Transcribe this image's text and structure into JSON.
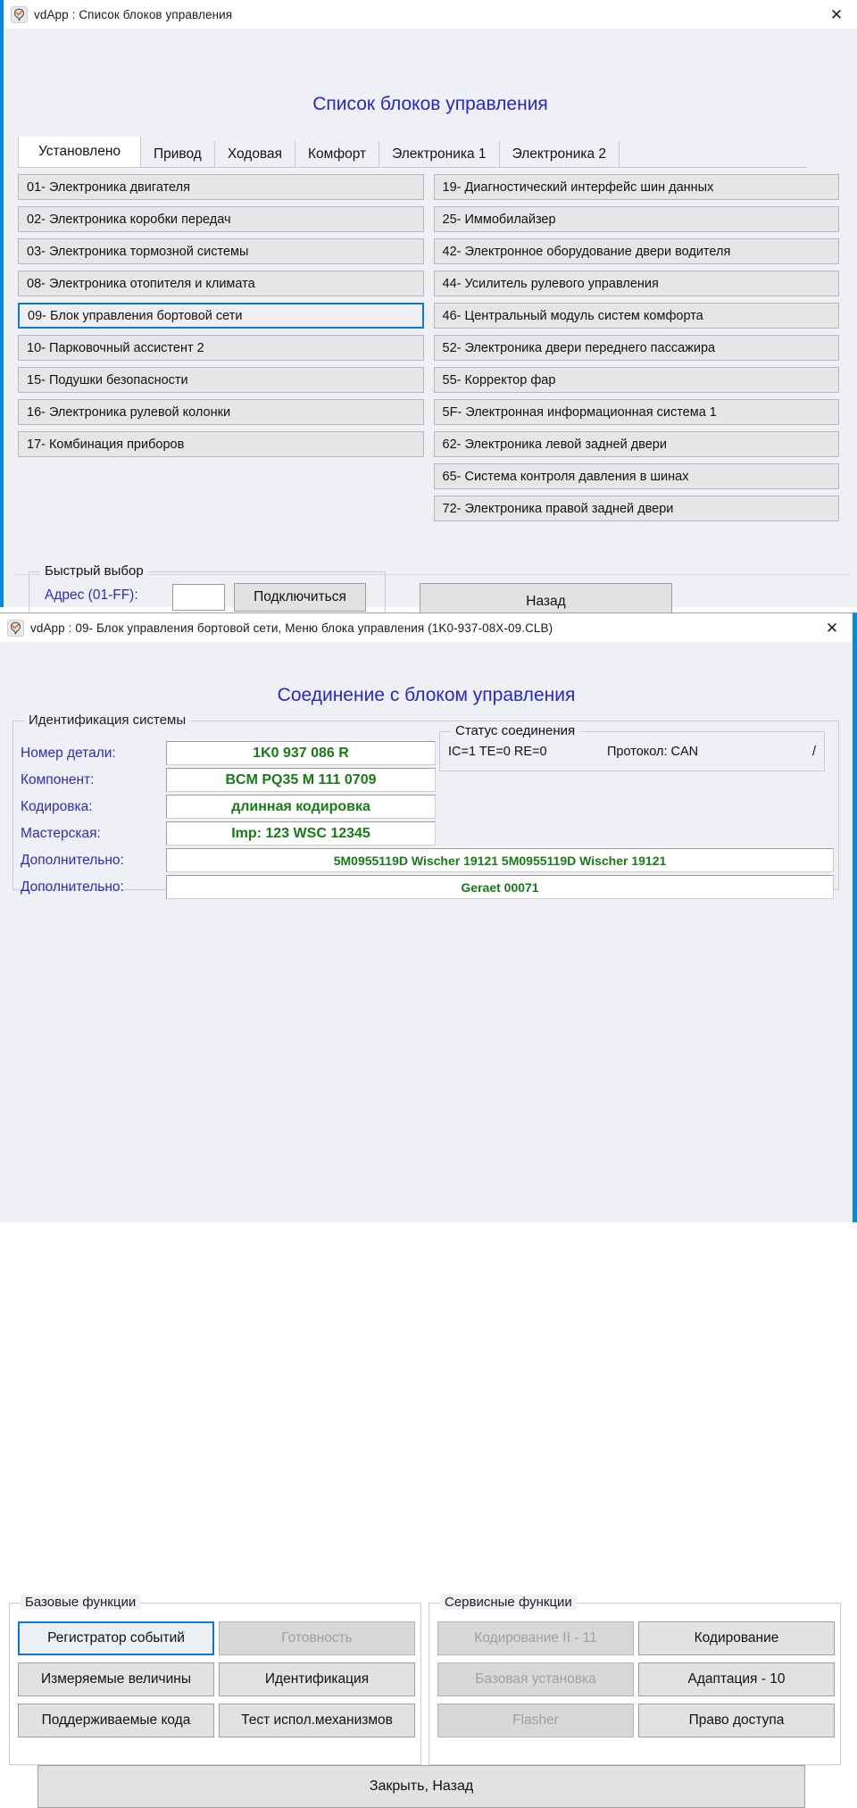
{
  "window1": {
    "title": "vdApp :  Список блоков управления",
    "close_label": "✕",
    "heading": "Список блоков управления",
    "tabs": [
      {
        "label": "Установлено",
        "active": true
      },
      {
        "label": "Привод",
        "active": false
      },
      {
        "label": "Ходовая",
        "active": false
      },
      {
        "label": "Комфорт",
        "active": false
      },
      {
        "label": "Электроника 1",
        "active": false
      },
      {
        "label": "Электроника 2",
        "active": false
      }
    ],
    "ecu_left": [
      {
        "label": "01- Электроника двигателя",
        "selected": false
      },
      {
        "label": "02- Электроника коробки передач",
        "selected": false
      },
      {
        "label": "03- Электроника тормозной системы",
        "selected": false
      },
      {
        "label": "08- Электроника отопителя и климата",
        "selected": false
      },
      {
        "label": "09- Блок управления бортовой сети",
        "selected": true
      },
      {
        "label": "10- Парковочный ассистент 2",
        "selected": false
      },
      {
        "label": "15- Подушки безопасности",
        "selected": false
      },
      {
        "label": "16- Электроника рулевой колонки",
        "selected": false
      },
      {
        "label": "17- Комбинация приборов",
        "selected": false
      }
    ],
    "ecu_right": [
      {
        "label": "19- Диагностический интерфейс шин данных",
        "selected": false
      },
      {
        "label": "25- Иммобилайзер",
        "selected": false
      },
      {
        "label": "42- Электронное оборудование двери водителя",
        "selected": false
      },
      {
        "label": "44- Усилитель рулевого управления",
        "selected": false
      },
      {
        "label": "46- Центральный модуль систем комфорта",
        "selected": false
      },
      {
        "label": "52- Электроника двери переднего пассажира",
        "selected": false
      },
      {
        "label": "55- Корректор фар",
        "selected": false
      },
      {
        "label": "5F- Электронная информационная система 1",
        "selected": false
      },
      {
        "label": "62- Электроника левой задней двери",
        "selected": false
      },
      {
        "label": "65- Система контроля давления в шинах",
        "selected": false
      },
      {
        "label": "72- Электроника правой задней двери",
        "selected": false
      }
    ],
    "quick_select": {
      "legend": "Быстрый выбор",
      "address_label": "Адрес (01-FF):",
      "address_value": "",
      "address_placeholder": "",
      "connect_label": "Подключиться"
    },
    "back_label": "Назад"
  },
  "window2": {
    "title": "vdApp : 09- Блок управления бортовой сети,  Меню блока управления (1K0-937-08X-09.CLB)",
    "close_label": "✕",
    "heading": "Соединение с блоком управления",
    "ident": {
      "legend": "Идентификация системы",
      "fields": [
        {
          "label": "Номер детали:",
          "value": "1K0 937 086 R"
        },
        {
          "label": "Компонент:",
          "value": "BCM PQ35  M   111 0709"
        },
        {
          "label": "Кодировка:",
          "value": "длинная кодировка"
        },
        {
          "label": "Мастерская:",
          "value": "Imp: 123     WSC 12345"
        },
        {
          "label": "Дополнительно:",
          "value": "5M0955119D Wischer 19121  5M0955119D Wischer 19121"
        },
        {
          "label": "Дополнительно:",
          "value": "Geraet 00071"
        }
      ]
    },
    "status": {
      "legend": "Статус соединения",
      "counters": "IC=1 TE=0  RE=0",
      "protocol": "Протокол: CAN",
      "spinner": "/"
    },
    "base_functions": {
      "legend": "Базовые функции",
      "buttons": [
        {
          "label": "Регистратор событий",
          "disabled": false,
          "focused": true
        },
        {
          "label": "Готовность",
          "disabled": true,
          "focused": false
        },
        {
          "label": "Измеряемые величины",
          "disabled": false,
          "focused": false
        },
        {
          "label": "Идентификация",
          "disabled": false,
          "focused": false
        },
        {
          "label": "Поддерживаемые кода",
          "disabled": false,
          "focused": false
        },
        {
          "label": "Тест испол.механизмов",
          "disabled": false,
          "focused": false
        }
      ]
    },
    "service_functions": {
      "legend": "Сервисные функции",
      "buttons": [
        {
          "label": "Кодирование II - 11",
          "disabled": true,
          "focused": false
        },
        {
          "label": "Кодирование",
          "disabled": false,
          "focused": false
        },
        {
          "label": "Базовая установка",
          "disabled": true,
          "focused": false
        },
        {
          "label": "Адаптация - 10",
          "disabled": false,
          "focused": false
        },
        {
          "label": "Flasher",
          "disabled": true,
          "focused": false
        },
        {
          "label": "Право доступа",
          "disabled": false,
          "focused": false
        }
      ]
    },
    "close_back_label": "Закрыть, Назад"
  },
  "colors": {
    "accent_blue": "#0b88d4",
    "heading_blue": "#2727c4",
    "label_blue": "#2c2cb8",
    "value_green": "#187a18",
    "window_bg": "#eef0f6",
    "button_bg": "#e2e2e2",
    "selected_border": "#0a7ad6"
  },
  "icons": {
    "app_icon": "app-logo-icon",
    "close_icon": "close-icon"
  }
}
